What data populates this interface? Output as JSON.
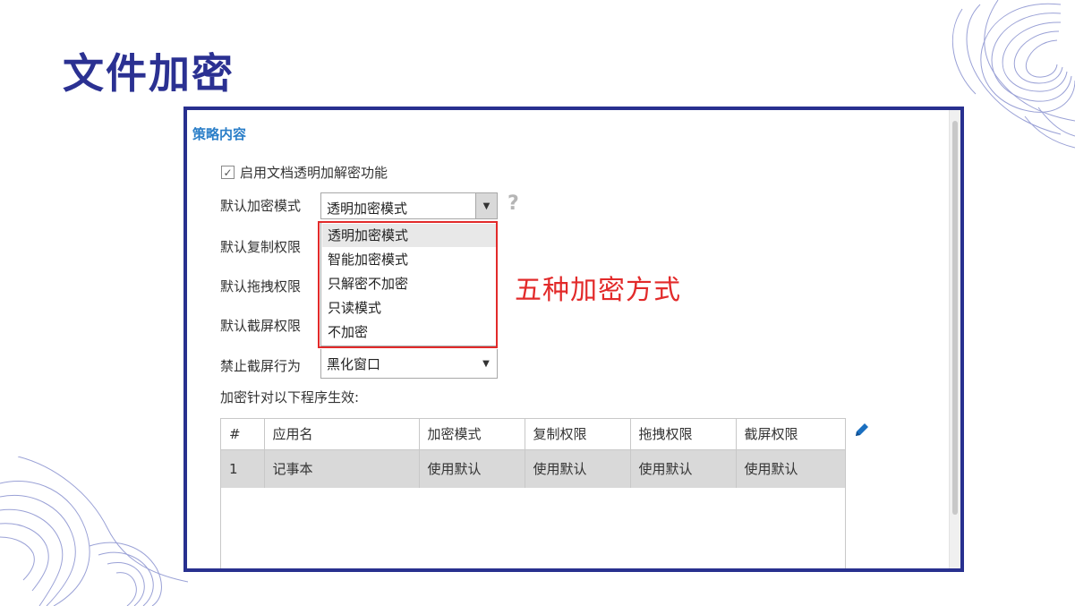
{
  "page": {
    "title": "文件加密"
  },
  "policy": {
    "section_title": "策略内容",
    "enable_checkbox": {
      "label": "启用文档透明加解密功能",
      "checked": true
    },
    "fields": [
      {
        "label": "默认加密模式",
        "value": "透明加密模式",
        "expanded": true
      },
      {
        "label": "默认复制权限",
        "value": ""
      },
      {
        "label": "默认拖拽权限",
        "value": ""
      },
      {
        "label": "默认截屏权限",
        "value": ""
      },
      {
        "label": "禁止截屏行为",
        "value": "黑化窗口"
      }
    ],
    "dropdown_options": [
      "透明加密模式",
      "智能加密模式",
      "只解密不加密",
      "只读模式",
      "不加密"
    ],
    "help_icon": "question-mark-icon",
    "annotation": "五种加密方式",
    "table_caption": "加密针对以下程序生效:",
    "table": {
      "headers": [
        "#",
        "应用名",
        "加密模式",
        "复制权限",
        "拖拽权限",
        "截屏权限"
      ],
      "rows": [
        [
          "1",
          "记事本",
          "使用默认",
          "使用默认",
          "使用默认",
          "使用默认"
        ]
      ]
    },
    "edit_icon": "pencil-icon"
  },
  "colors": {
    "title": "#2b3192",
    "frame_border": "#28308f",
    "section_title": "#2a7ec8",
    "annotation": "#e22a2a",
    "row_selected": "#d9d9d9",
    "decoration": "#8b93cc"
  }
}
